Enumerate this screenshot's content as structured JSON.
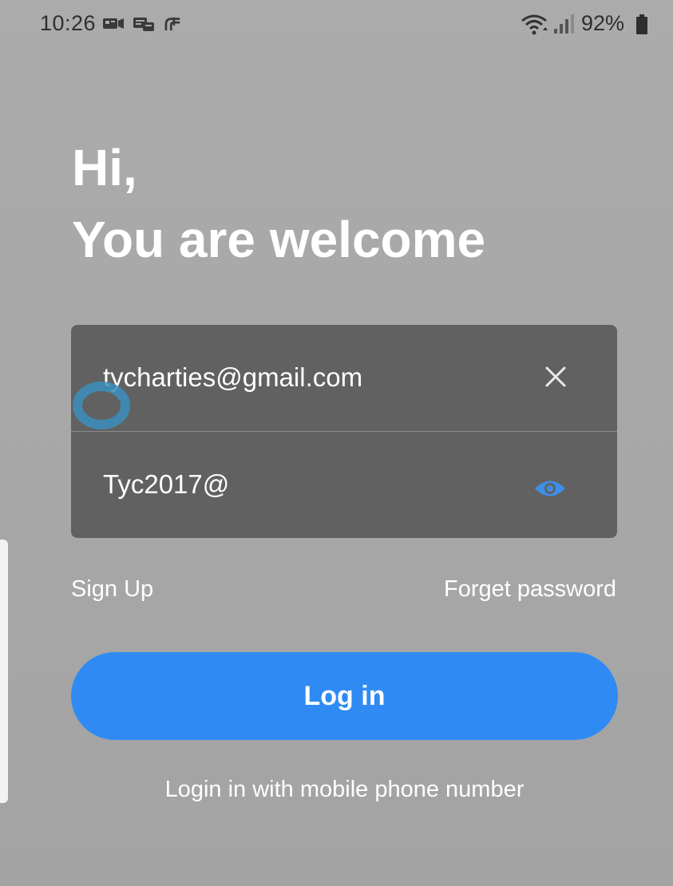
{
  "status_bar": {
    "time": "10:26",
    "battery": "92%",
    "notification_icons": [
      "notification-icon-1",
      "notification-icon-2",
      "notification-icon-3"
    ]
  },
  "greeting": {
    "line1": "Hi,",
    "line2": "You are welcome"
  },
  "form": {
    "email_value": "tycharties@gmail.com",
    "password_value": "Tyc2017@"
  },
  "links": {
    "sign_up": "Sign Up",
    "forget_password": "Forget password"
  },
  "login_button": "Log in",
  "mobile_login": "Login in with mobile phone number",
  "colors": {
    "accent": "#2f8bf3",
    "field_background": "#616161",
    "page_background": "#a8a8a8"
  }
}
